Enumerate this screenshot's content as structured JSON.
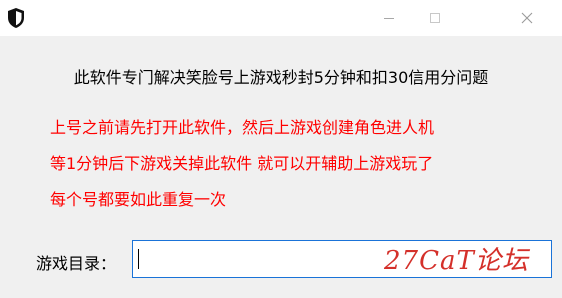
{
  "window": {
    "headline": "此软件专门解决笑脸号上游戏秒封5分钟和扣30信用分问题"
  },
  "instructions": [
    "上号之前请先打开此软件，然后上游戏创建角色进人机",
    "等1分钟后下游戏关掉此软件 就可以开辅助上游戏玩了",
    "每个号都要如此重复一次"
  ],
  "form": {
    "game_dir_label": "游戏目录：",
    "game_dir_value": ""
  },
  "watermark": "27CaT论坛",
  "colors": {
    "instruction_text": "#ff0000",
    "input_border": "#1a73d8",
    "watermark": "#d4302a"
  },
  "icons": {
    "app": "shield-icon",
    "minimize": "minimize-icon",
    "maximize": "maximize-icon",
    "close": "close-icon"
  }
}
